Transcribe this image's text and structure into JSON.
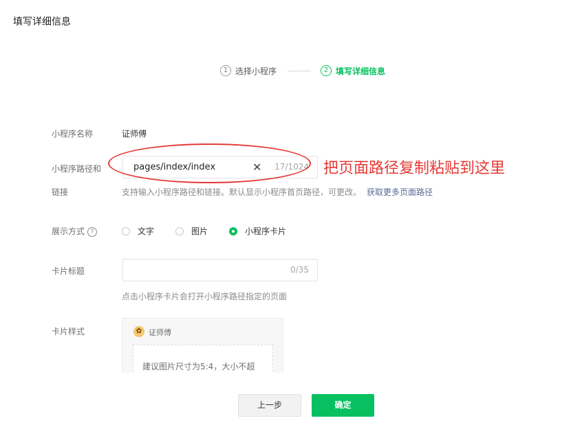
{
  "page_title": "填写详细信息",
  "steps": [
    {
      "num": "1",
      "label": "选择小程序",
      "active": false
    },
    {
      "num": "2",
      "label": "填写详细信息",
      "active": true
    }
  ],
  "form": {
    "name": {
      "label": "小程序名称",
      "value": "证师傅"
    },
    "path": {
      "label_line1": "小程序路径和",
      "label_line2": "链接",
      "value": "pages/index/index",
      "clear_icon": "close-icon",
      "count": "17/1024",
      "hint": "支持输入小程序路径和链接。默认显示小程序首页路径，可更改。",
      "hint_link": "获取更多页面路径"
    },
    "display": {
      "label": "展示方式",
      "help_icon": "question-circle-icon",
      "options": [
        "文字",
        "图片",
        "小程序卡片"
      ],
      "selected": "小程序卡片"
    },
    "card_title": {
      "label": "卡片标题",
      "value": "",
      "count": "0/35",
      "hint": "点击小程序卡片会打开小程序路径指定的页面"
    },
    "card_style": {
      "label": "卡片样式",
      "preview_name": "证师傅",
      "placeholder": "建议图片尺寸为5:4，大小不超"
    }
  },
  "annotation": {
    "text": "把页面路径复制粘贴到这里",
    "color": "#e53935"
  },
  "buttons": {
    "prev": "上一步",
    "confirm": "确定"
  },
  "colors": {
    "accent": "#07c160",
    "link": "#576b95"
  }
}
